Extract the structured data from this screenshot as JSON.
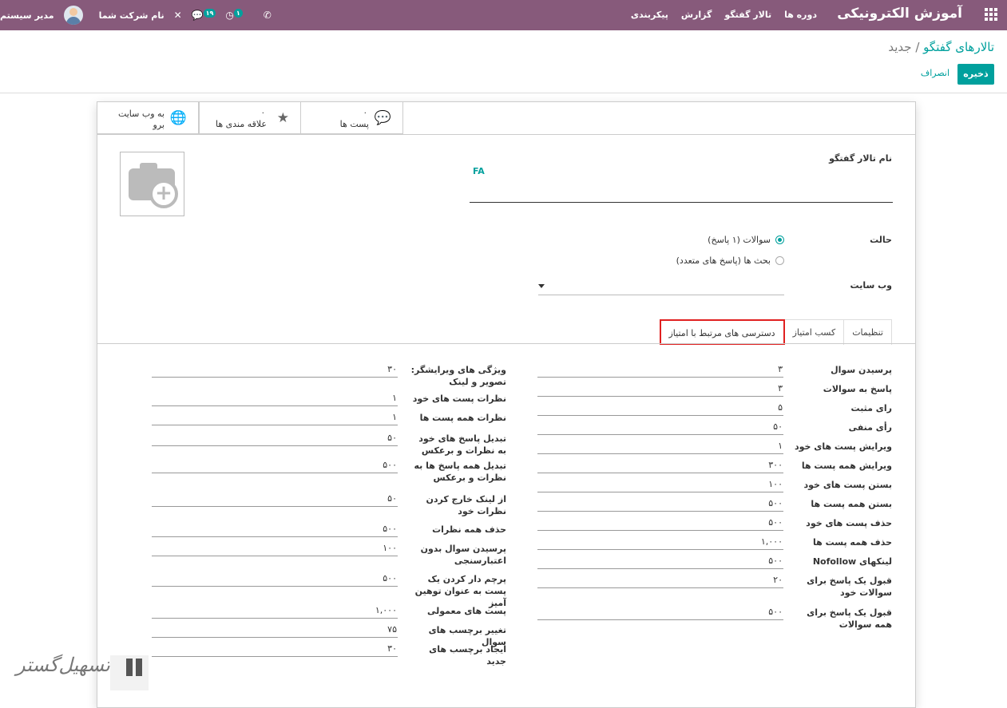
{
  "navbar": {
    "brand": "آموزش الکترونیکی",
    "menu": [
      "دوره ها",
      "تالار گفتگو",
      "گزارش",
      "پیکربندی"
    ],
    "user": "مدیر سیستم",
    "company": "نام شرکت شما",
    "messages_badge": "۱۹",
    "activities_badge": "۱"
  },
  "control_panel": {
    "breadcrumb_parent": "تالارهای گفتگو",
    "breadcrumb_sep": "/",
    "breadcrumb_current": "جدید",
    "save": "ذخیره",
    "discard": "انصراف"
  },
  "stats": {
    "posts": {
      "count": "۰",
      "label": "پست ها"
    },
    "favorites": {
      "count": "۰",
      "label": "علاقه مندی ها"
    },
    "website": {
      "line1": "به وب سایت",
      "line2": "برو"
    }
  },
  "form": {
    "name_label": "نام تالار گفتگو",
    "lang_tag": "FA",
    "mode_label": "حالت",
    "mode_option_1": "سوالات (۱ پاسخ)",
    "mode_option_2": "بحث ها (پاسخ های متعدد)",
    "website_label": "وب سایت"
  },
  "tabs": [
    "تنظیمات",
    "کسب امتیاز",
    "دسترسی های مرتبط با امتیاز"
  ],
  "karma_right": [
    {
      "label": "پرسیدن سوال",
      "value": "۳"
    },
    {
      "label": "پاسخ به سوالات",
      "value": "۳"
    },
    {
      "label": "رای مثبت",
      "value": "۵"
    },
    {
      "label": "رأی منفی",
      "value": "۵۰"
    },
    {
      "label": "ویرایش پست های خود",
      "value": "۱"
    },
    {
      "label": "ویرایش همه پست ها",
      "value": "۳۰۰"
    },
    {
      "label": "بستن پست های خود",
      "value": "۱۰۰"
    },
    {
      "label": "بستن همه پست ها",
      "value": "۵۰۰"
    },
    {
      "label": "حذف پست های خود",
      "value": "۵۰۰"
    },
    {
      "label": "حذف همه پست ها",
      "value": "۱,۰۰۰"
    },
    {
      "label": "لینکهای Nofollow",
      "value": "۵۰۰"
    },
    {
      "label": "قبول یک پاسخ برای سوالات خود",
      "value": "۲۰"
    },
    {
      "label": "قبول یک پاسخ برای همه سوالات",
      "value": "۵۰۰"
    }
  ],
  "karma_left": [
    {
      "label": "ویژگی های ویرایشگر: تصویر و لینک",
      "value": "۳۰"
    },
    {
      "label": "نظرات پست های خود",
      "value": "۱"
    },
    {
      "label": "نظرات همه پست ها",
      "value": "۱"
    },
    {
      "label": "تبدیل پاسخ های خود به نظرات و برعکس",
      "value": "۵۰"
    },
    {
      "label": "تبدیل همه پاسخ ها به نظرات و برعکس",
      "value": "۵۰۰"
    },
    {
      "label": "از لینک خارج کردن نظرات خود",
      "value": "۵۰"
    },
    {
      "label": "حذف همه نظرات",
      "value": "۵۰۰"
    },
    {
      "label": "پرسیدن سوال بدون اعتبارسنجی",
      "value": "۱۰۰"
    },
    {
      "label": "پرچم دار کردن یک پست به عنوان توهین آمیز",
      "value": "۵۰۰"
    },
    {
      "label": "پست های معمولی",
      "value": "۱,۰۰۰"
    },
    {
      "label": "تغییر برچسب های سوال",
      "value": "۷۵"
    },
    {
      "label": "ایجاد برچسب های جدید",
      "value": "۳۰"
    }
  ],
  "watermark": {
    "text": "تسهیل‌گستر"
  }
}
